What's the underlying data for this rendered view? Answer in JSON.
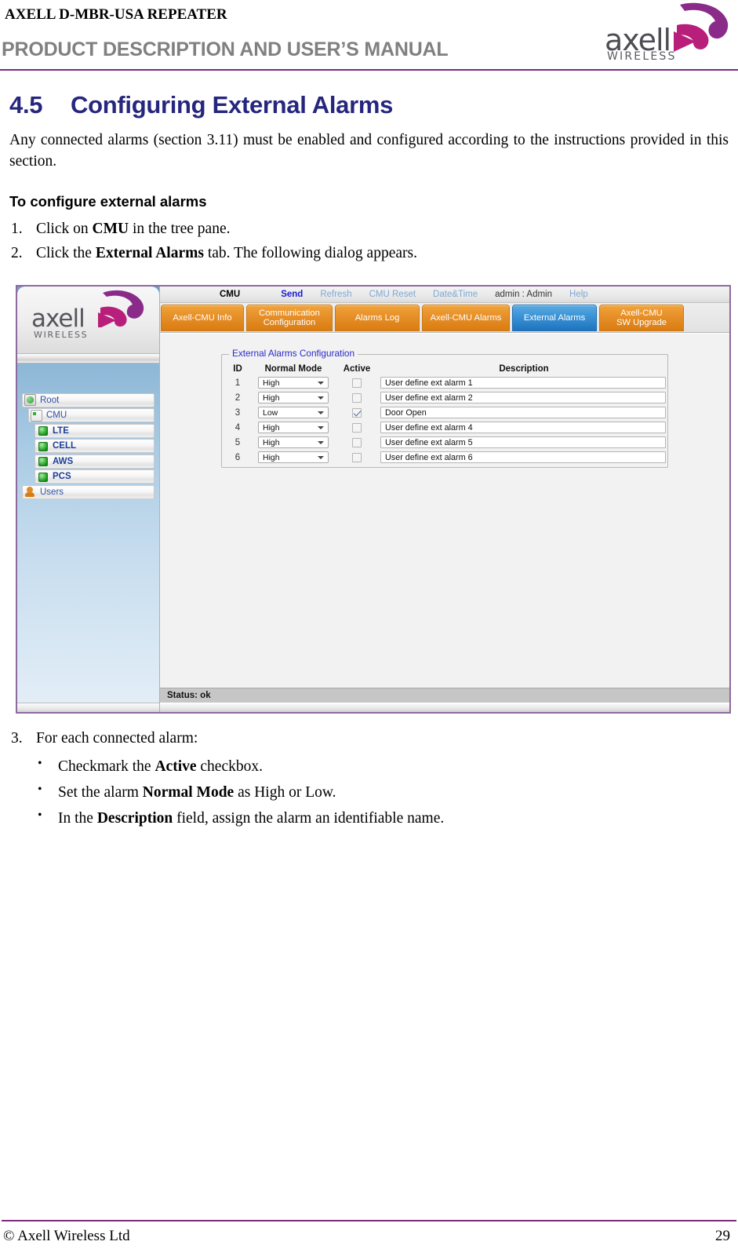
{
  "header": {
    "product_line": "AXELL D-MBR-USA REPEATER",
    "manual_title": "PRODUCT DESCRIPTION AND USER’S MANUAL",
    "logo_word": "axell",
    "logo_sub": "WIRELESS",
    "rule_color": "#7b2d7b"
  },
  "section": {
    "number": "4.5",
    "title": "Configuring External Alarms",
    "title_color": "#26267f",
    "intro": "Any connected alarms (section 3.11) must be enabled and configured according to the instructions provided in this section.",
    "procedure_heading": "To configure external alarms",
    "steps": [
      {
        "marker": "1.",
        "pre": "Click on ",
        "bold": "CMU",
        "post": " in the tree pane."
      },
      {
        "marker": "2.",
        "pre": "Click the ",
        "bold": "External Alarms",
        "post": " tab. The following dialog appears."
      },
      {
        "marker": "3.",
        "pre": "For each connected alarm:",
        "bold": "",
        "post": ""
      }
    ],
    "bullets": [
      {
        "bullet": "•",
        "pre": "Checkmark the ",
        "bold": "Active",
        "post": " checkbox."
      },
      {
        "bullet": "•",
        "pre": "Set the alarm ",
        "bold": "Normal Mode",
        "post": " as High or Low."
      },
      {
        "bullet": "•",
        "pre": "In the ",
        "bold": "Description",
        "post": " field, assign the alarm an identifiable name."
      }
    ]
  },
  "app": {
    "logo_word": "axell",
    "logo_sub": "WIRELESS",
    "tree": {
      "items": [
        {
          "label": "Root",
          "level": 1,
          "icon": "root-node-icon",
          "bold": false
        },
        {
          "label": "CMU",
          "level": 2,
          "icon": "cmu-node-icon",
          "bold": false
        },
        {
          "label": "LTE",
          "level": 3,
          "icon": "band-node-icon",
          "bold": true
        },
        {
          "label": "CELL",
          "level": 3,
          "icon": "band-node-icon",
          "bold": true
        },
        {
          "label": "AWS",
          "level": 3,
          "icon": "band-node-icon",
          "bold": true
        },
        {
          "label": "PCS",
          "level": 3,
          "icon": "band-node-icon",
          "bold": true
        },
        {
          "label": "Users",
          "level": 1,
          "icon": "users-node-icon",
          "bold": false
        }
      ]
    },
    "menubar": {
      "title": "CMU",
      "items": [
        {
          "label": "Send",
          "style": "send"
        },
        {
          "label": "Refresh",
          "style": "link"
        },
        {
          "label": "CMU Reset",
          "style": "link"
        },
        {
          "label": "Date&Time",
          "style": "link"
        },
        {
          "label": "admin : Admin",
          "style": "user"
        },
        {
          "label": "Help",
          "style": "link"
        }
      ]
    },
    "tabs": [
      {
        "label": "Axell-CMU Info",
        "selected": false
      },
      {
        "label": "Communication\nConfiguration",
        "selected": false
      },
      {
        "label": "Alarms Log",
        "selected": false
      },
      {
        "label": "Axell-CMU Alarms",
        "selected": false
      },
      {
        "label": "External Alarms",
        "selected": true
      },
      {
        "label": "Axell-CMU\nSW Upgrade",
        "selected": false
      }
    ],
    "group_title": "External Alarms Configuration",
    "table": {
      "columns": [
        "ID",
        "Normal Mode",
        "Active",
        "Description"
      ],
      "rows": [
        {
          "id": "1",
          "mode": "High",
          "active": false,
          "description": "User define ext alarm 1"
        },
        {
          "id": "2",
          "mode": "High",
          "active": false,
          "description": "User define ext alarm 2"
        },
        {
          "id": "3",
          "mode": "Low",
          "active": true,
          "description": "Door Open"
        },
        {
          "id": "4",
          "mode": "High",
          "active": false,
          "description": "User define ext alarm 4"
        },
        {
          "id": "5",
          "mode": "High",
          "active": false,
          "description": "User define ext alarm 5"
        },
        {
          "id": "6",
          "mode": "High",
          "active": false,
          "description": "User define ext alarm 6"
        }
      ]
    },
    "status": "Status: ok",
    "colors": {
      "tab_normal": "#e8912a",
      "tab_selected": "#3a92d6",
      "group_legend": "#2b2bcc",
      "tree_label": "#2f4fa0"
    }
  },
  "footer": {
    "copyright": "© Axell Wireless Ltd",
    "page": "29"
  }
}
